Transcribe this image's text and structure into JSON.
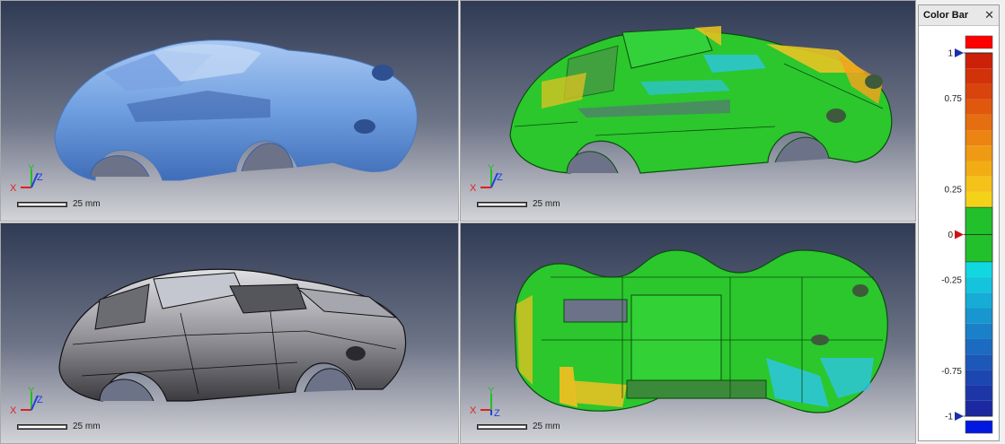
{
  "viewports": [
    {
      "scale_label": "25 mm",
      "axes": {
        "x": "X",
        "y": "Y",
        "z": "Z"
      },
      "render_mode": "shaded-blue"
    },
    {
      "scale_label": "25 mm",
      "axes": {
        "x": "X",
        "y": "Y",
        "z": "Z"
      },
      "render_mode": "deviation-map"
    },
    {
      "scale_label": "25 mm",
      "axes": {
        "x": "X",
        "y": "Y",
        "z": "Z"
      },
      "render_mode": "cad-wireframe"
    },
    {
      "scale_label": "25 mm",
      "axes": {
        "x": "X",
        "y": "Y",
        "z": "Z"
      },
      "render_mode": "deviation-map-top"
    }
  ],
  "color_bar": {
    "title": "Color Bar",
    "close_symbol": "✕",
    "labels": [
      {
        "text": "1",
        "value": 1.0,
        "marker": true,
        "marker_color": "#1a2fb0"
      },
      {
        "text": "0.75",
        "value": 0.75
      },
      {
        "text": "0.25",
        "value": 0.25
      },
      {
        "text": "0",
        "value": 0.0,
        "marker": true,
        "marker_color": "#d01010"
      },
      {
        "text": "-0.25",
        "value": -0.25
      },
      {
        "text": "-0.75",
        "value": -0.75
      },
      {
        "text": "-1",
        "value": -1.0,
        "marker": true,
        "marker_color": "#1a2fb0"
      }
    ],
    "range": [
      -1,
      1
    ],
    "tolerance": [
      -0.15,
      0.15
    ],
    "upper_out_color": "#ff0000",
    "lower_out_color": "#0018e0",
    "tolerance_color": "#22c02a",
    "positive_colors": [
      "#f5d21a",
      "#f4c218",
      "#f2ad15",
      "#ef9a14",
      "#eb8412",
      "#e56e10",
      "#df580e",
      "#d8440c",
      "#d2320a",
      "#cc2008"
    ],
    "negative_colors": [
      "#11d8e0",
      "#14c4dc",
      "#16acd6",
      "#1896cf",
      "#1a80c8",
      "#1b6cc0",
      "#1c58b8",
      "#1c46b0",
      "#1c36a8",
      "#1c28a0"
    ]
  }
}
